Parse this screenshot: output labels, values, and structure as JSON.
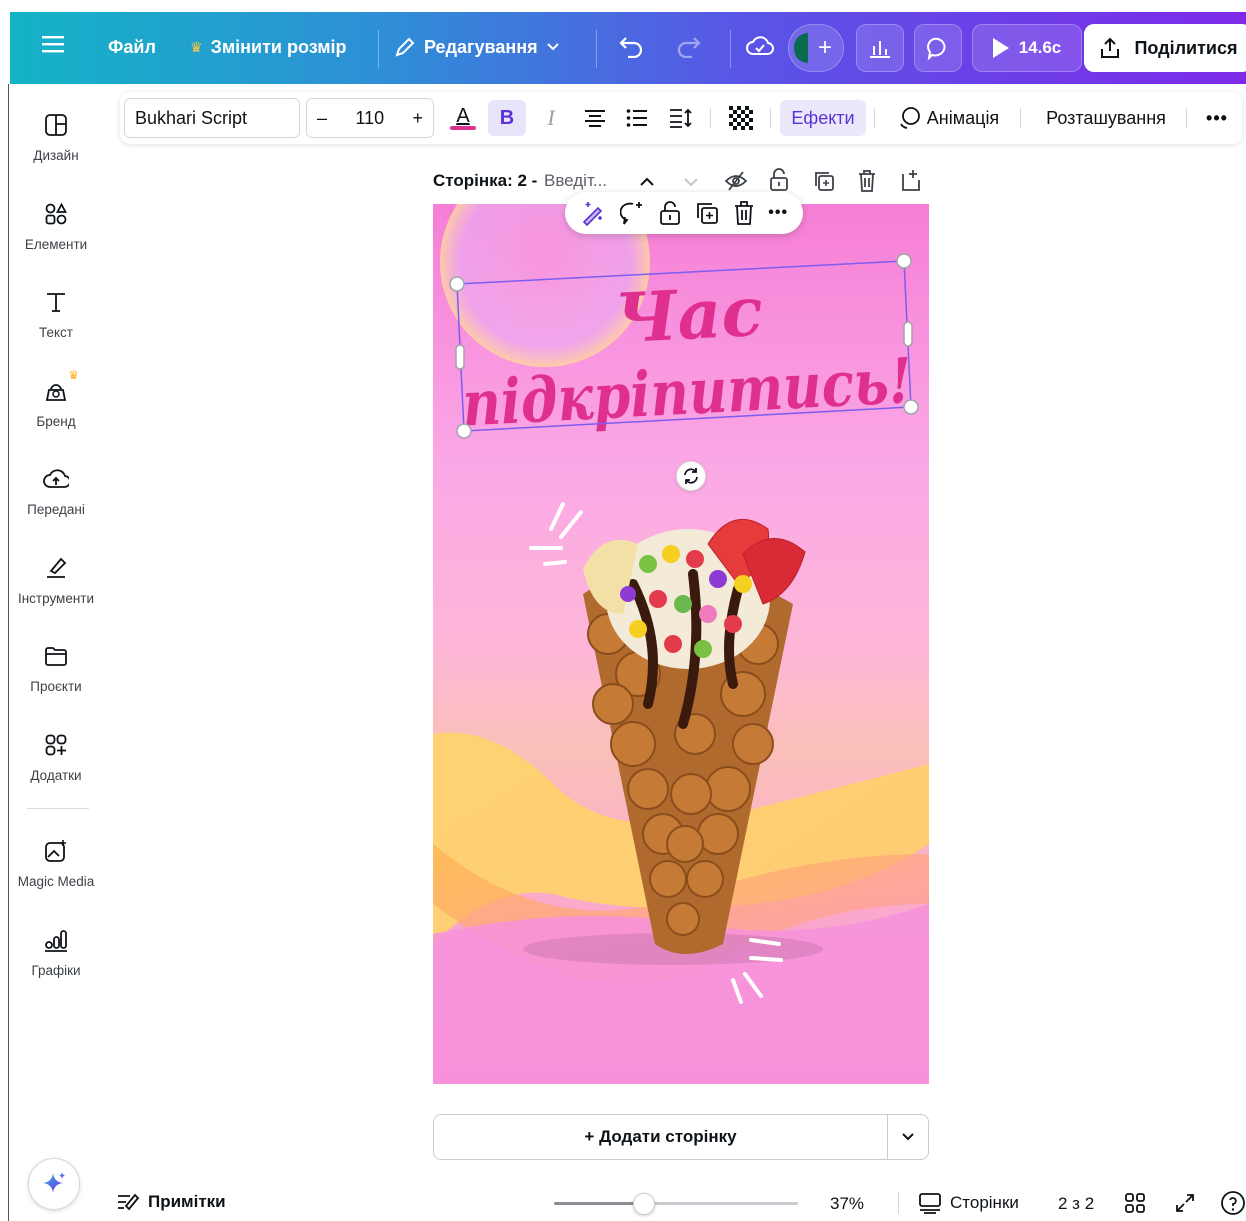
{
  "topbar": {
    "file": "Файл",
    "resize": "Змінити розмір",
    "edit": "Редагування",
    "timer": "14.6с",
    "share": "Поділитися"
  },
  "sidebar": {
    "items": [
      {
        "label": "Дизайн",
        "icon": "layout-icon"
      },
      {
        "label": "Елементи",
        "icon": "elements-icon"
      },
      {
        "label": "Текст",
        "icon": "text-icon"
      },
      {
        "label": "Бренд",
        "icon": "brand-icon"
      },
      {
        "label": "Передані",
        "icon": "upload-icon"
      },
      {
        "label": "Інструменти",
        "icon": "draw-icon"
      },
      {
        "label": "Проєкти",
        "icon": "folder-icon"
      },
      {
        "label": "Додатки",
        "icon": "apps-icon"
      },
      {
        "label": "Magic Media",
        "icon": "magic-media-icon"
      },
      {
        "label": "Графіки",
        "icon": "charts-icon"
      }
    ]
  },
  "textbar": {
    "font": "Bukhari Script",
    "size": "110",
    "minus": "–",
    "plus": "+",
    "effects": "Ефекти",
    "animation": "Анімація",
    "position": "Розташування",
    "text_color": "#e0308f"
  },
  "page": {
    "label": "Сторінка: 2 -",
    "title_placeholder": "Введіт..."
  },
  "design": {
    "headline_line1": "Час",
    "headline_line2": "підкріпитись!",
    "headline_color": "#e0308f"
  },
  "add_page": {
    "label": "+ Додати сторінку"
  },
  "footer": {
    "notes": "Примітки",
    "zoom": "37%",
    "zoom_level": 0.37,
    "pages": "Сторінки",
    "page_count": "2 з 2"
  }
}
